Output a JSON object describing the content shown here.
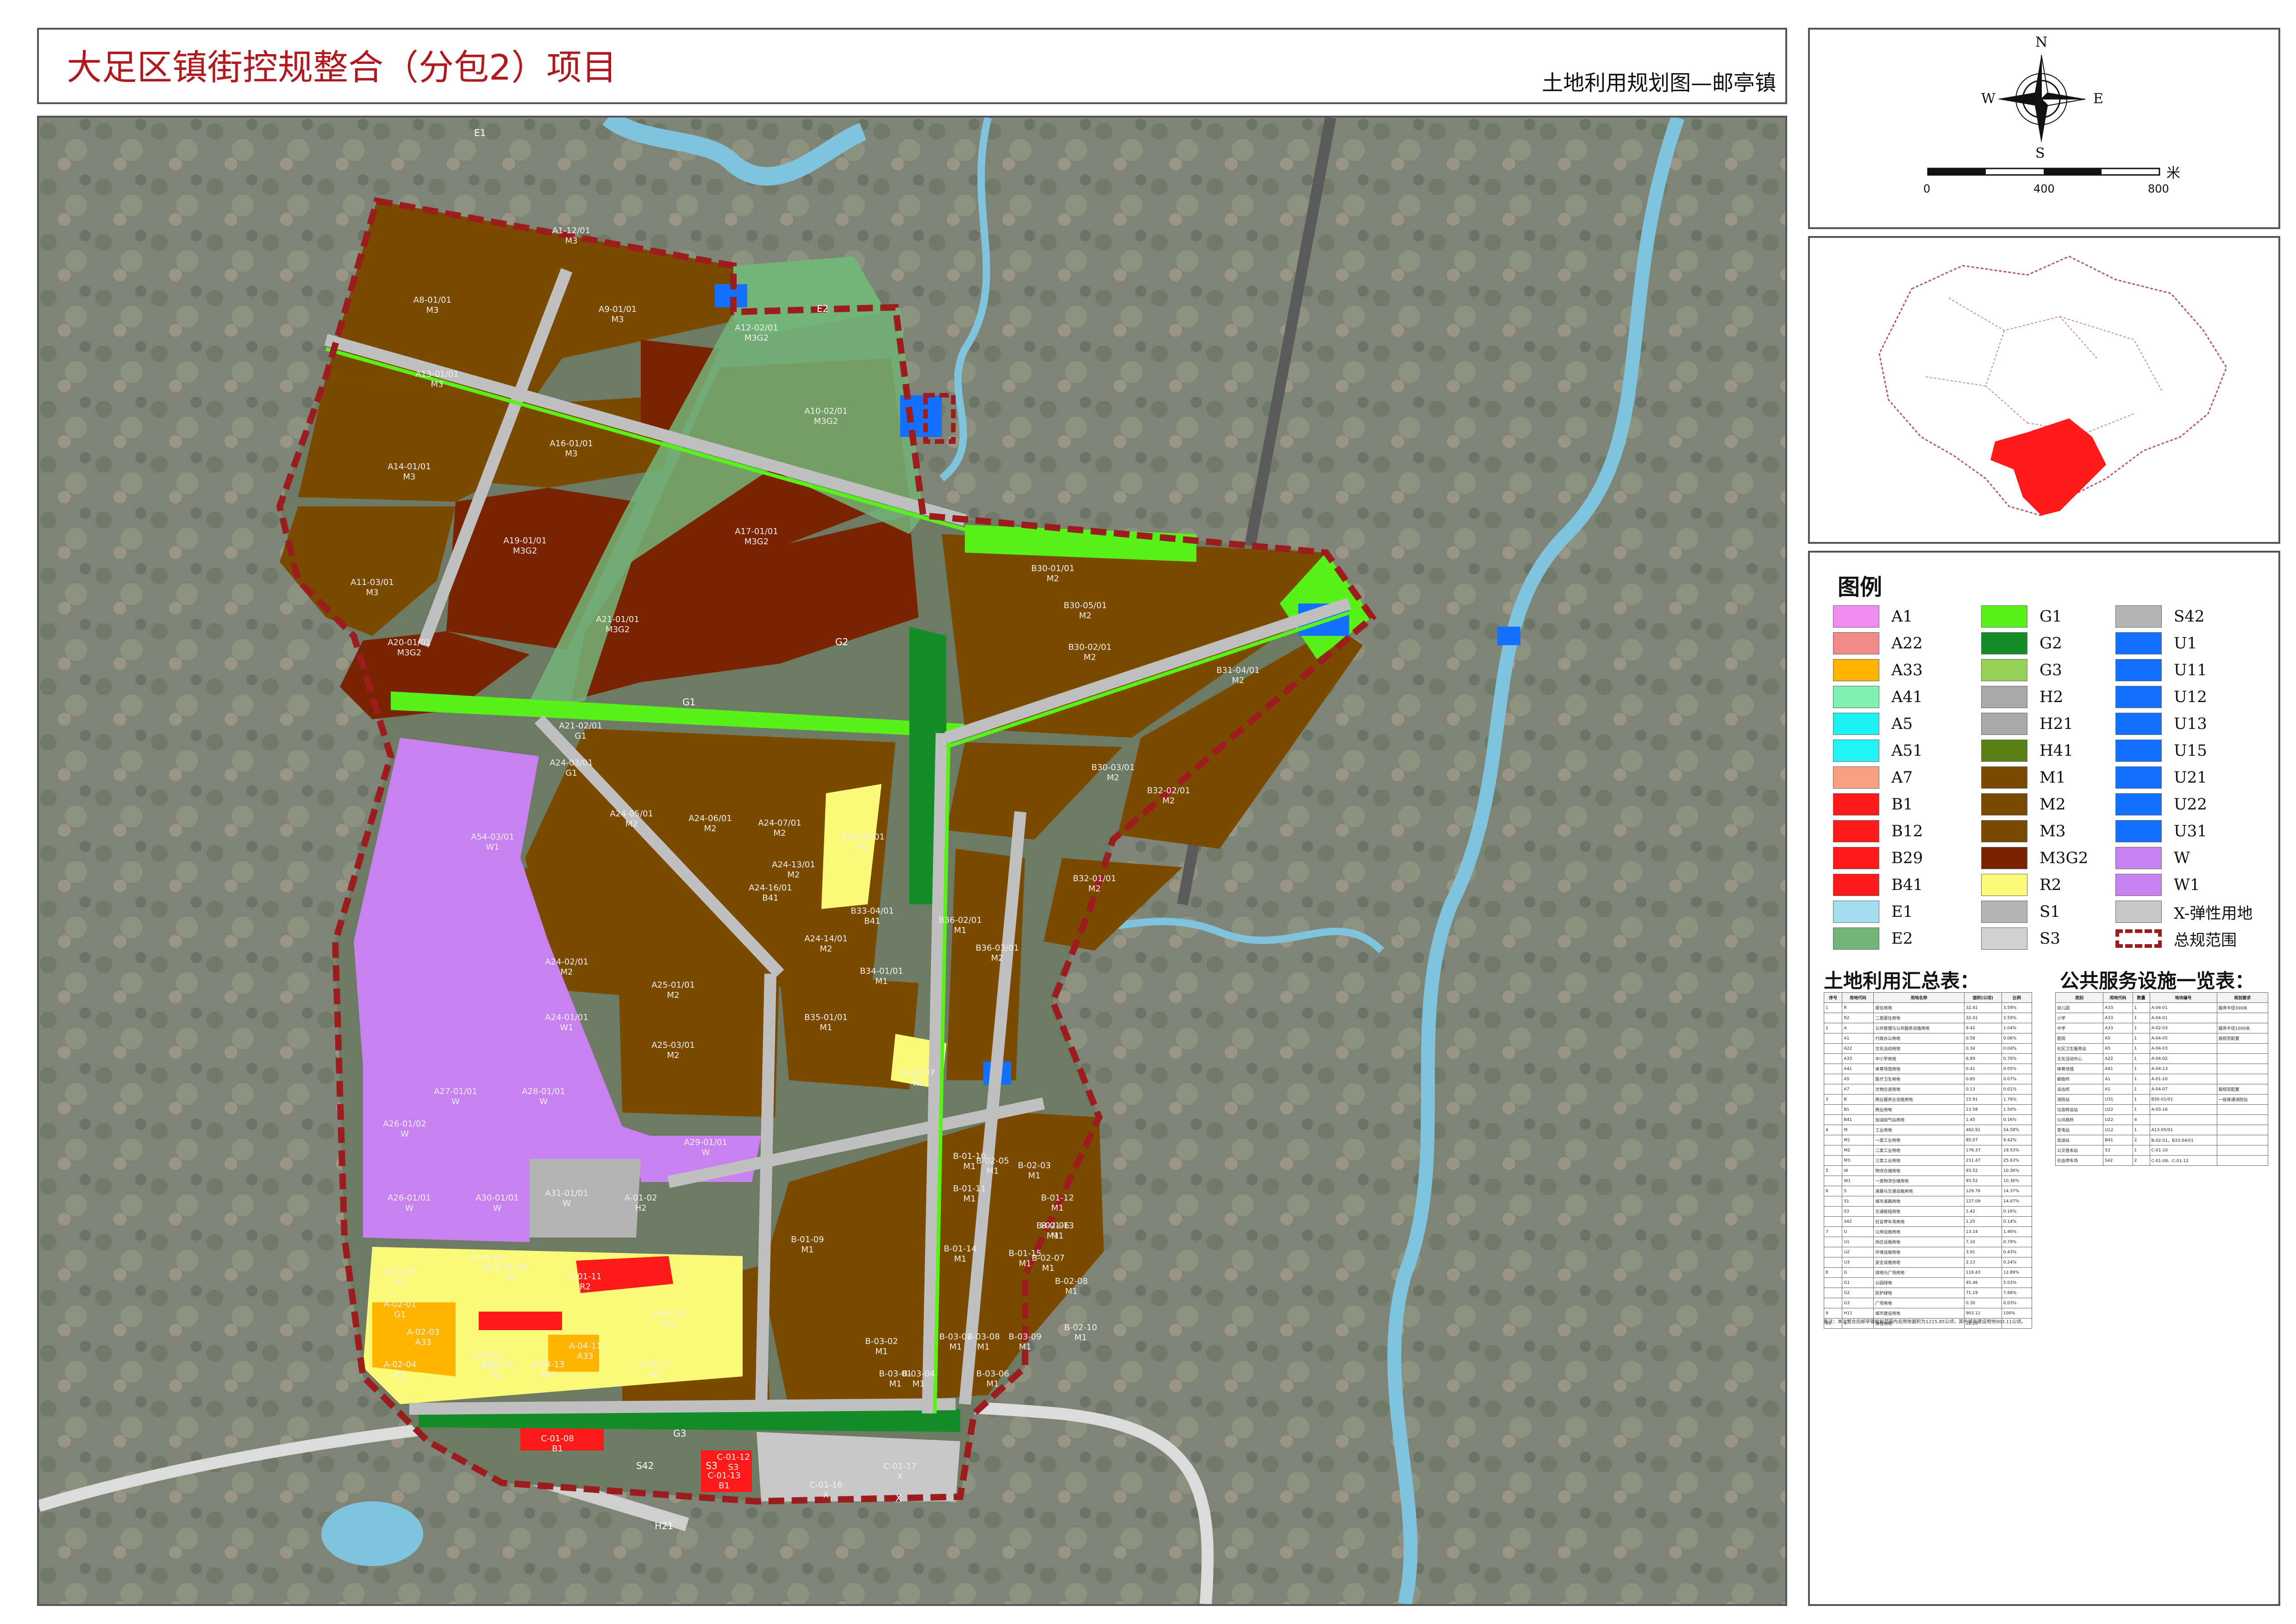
{
  "header": {
    "title": "大足区镇街控规整合（分包2）项目",
    "subtitle": "土地利用规划图—邮亭镇"
  },
  "compass": {
    "north": "N",
    "south": "S",
    "east": "E",
    "west": "W"
  },
  "scale_bar": {
    "ticks": [
      "0",
      "400",
      "800"
    ],
    "unit": "米"
  },
  "legend": {
    "title": "图例",
    "items": [
      {
        "code": "A1",
        "color": "#f08cf0"
      },
      {
        "code": "A22",
        "color": "#f08a86"
      },
      {
        "code": "A33",
        "color": "#ffb400"
      },
      {
        "code": "A41",
        "color": "#7ff2b2"
      },
      {
        "code": "A5",
        "color": "#1ef2f2"
      },
      {
        "code": "A51",
        "color": "#22f5f5"
      },
      {
        "code": "A7",
        "color": "#f7a182"
      },
      {
        "code": "B1",
        "color": "#ff1a1a"
      },
      {
        "code": "B12",
        "color": "#ff1a1a"
      },
      {
        "code": "B29",
        "color": "#ff1a1a"
      },
      {
        "code": "B41",
        "color": "#ff1a1a"
      },
      {
        "code": "E1",
        "color": "#a6dcf0"
      },
      {
        "code": "E2",
        "color": "#73b478"
      },
      {
        "code": "G1",
        "color": "#59f218"
      },
      {
        "code": "G2",
        "color": "#148c28"
      },
      {
        "code": "G3",
        "color": "#96d25a"
      },
      {
        "code": "H2",
        "color": "#a8a8a8"
      },
      {
        "code": "H21",
        "color": "#a8a8a8"
      },
      {
        "code": "H41",
        "color": "#5a8214"
      },
      {
        "code": "M1",
        "color": "#7a4a00"
      },
      {
        "code": "M2",
        "color": "#7a4a00"
      },
      {
        "code": "M3",
        "color": "#7a4a00"
      },
      {
        "code": "M3G2",
        "color": "#7a2300"
      },
      {
        "code": "R2",
        "color": "#fafa78"
      },
      {
        "code": "S1",
        "color": "#b4b4b4"
      },
      {
        "code": "S3",
        "color": "#d2d2d2"
      },
      {
        "code": "S42",
        "color": "#b4b4b4"
      },
      {
        "code": "U1",
        "color": "#1470ff"
      },
      {
        "code": "U11",
        "color": "#1470ff"
      },
      {
        "code": "U12",
        "color": "#1470ff"
      },
      {
        "code": "U13",
        "color": "#1470ff"
      },
      {
        "code": "U15",
        "color": "#1470ff"
      },
      {
        "code": "U21",
        "color": "#1470ff"
      },
      {
        "code": "U22",
        "color": "#1470ff"
      },
      {
        "code": "U31",
        "color": "#1470ff"
      },
      {
        "code": "W",
        "color": "#c882f0"
      },
      {
        "code": "W1",
        "color": "#c882f0"
      },
      {
        "code": "X-弹性用地",
        "color": "#c8c8c8"
      },
      {
        "code": "总规范围",
        "color": "#9c1d1d"
      }
    ]
  },
  "land_table": {
    "title": "土地利用汇总表：",
    "headers": [
      "序号",
      "用地代码",
      "用地名称",
      "面积(公顷)",
      "比例"
    ],
    "rows": [
      [
        "1",
        "R",
        "居住用地",
        "",
        "32.41",
        "3.59%"
      ],
      [
        "",
        "R2",
        "二类居住用地",
        "",
        "32.41",
        "3.59%"
      ],
      [
        "2",
        "A",
        "公共管理与公共服务设施用地",
        "",
        "9.42",
        "1.04%"
      ],
      [
        "",
        "A1",
        "行政办公用地",
        "",
        "0.58",
        "0.06%"
      ],
      [
        "",
        "A22",
        "文化活动用地",
        "",
        "0.34",
        "0.04%"
      ],
      [
        "",
        "A33",
        "中小学用地",
        "",
        "6.89",
        "0.76%"
      ],
      [
        "",
        "A41",
        "体育场馆用地",
        "",
        "0.41",
        "0.05%"
      ],
      [
        "",
        "A5",
        "医疗卫生用地",
        "",
        "0.65",
        "0.07%"
      ],
      [
        "",
        "A7",
        "文物古迹用地",
        "",
        "0.13",
        "0.01%"
      ],
      [
        "3",
        "B",
        "商业服务业设施用地",
        "",
        "15.91",
        "1.76%"
      ],
      [
        "",
        "B1",
        "商业用地",
        "",
        "13.58",
        "1.50%"
      ],
      [
        "",
        "B41",
        "加油加气站用地",
        "",
        "1.45",
        "0.16%"
      ],
      [
        "4",
        "M",
        "工业用地",
        "",
        "492.91",
        "54.58%"
      ],
      [
        "",
        "M1",
        "一类工业用地",
        "",
        "85.07",
        "9.42%"
      ],
      [
        "",
        "M2",
        "二类工业用地",
        "",
        "176.37",
        "19.53%"
      ],
      [
        "",
        "M3",
        "三类工业用地",
        "",
        "231.47",
        "25.63%"
      ],
      [
        "5",
        "W",
        "物流仓储用地",
        "",
        "93.52",
        "10.36%"
      ],
      [
        "",
        "W1",
        "一类物流仓储用地",
        "",
        "93.52",
        "10.36%"
      ],
      [
        "6",
        "S",
        "道路与交通设施用地",
        "",
        "129.76",
        "14.37%"
      ],
      [
        "",
        "S1",
        "城市道路用地",
        "",
        "127.09",
        "14.07%"
      ],
      [
        "",
        "S3",
        "交通枢纽用地",
        "",
        "1.42",
        "0.16%"
      ],
      [
        "",
        "S42",
        "社会停车场用地",
        "",
        "1.25",
        "0.14%"
      ],
      [
        "7",
        "U",
        "公用设施用地",
        "",
        "13.14",
        "1.46%"
      ],
      [
        "",
        "U1",
        "供应设施用地",
        "",
        "7.10",
        "0.79%"
      ],
      [
        "",
        "U2",
        "环境设施用地",
        "",
        "3.91",
        "0.43%"
      ],
      [
        "",
        "U3",
        "安全设施用地",
        "",
        "2.13",
        "0.24%"
      ],
      [
        "8",
        "G",
        "绿地与广场用地",
        "",
        "116.43",
        "12.89%"
      ],
      [
        "",
        "G1",
        "公园绿地",
        "",
        "45.46",
        "5.03%"
      ],
      [
        "",
        "G2",
        "防护绿地",
        "",
        "71.19",
        "7.88%"
      ],
      [
        "",
        "G3",
        "广场用地",
        "",
        "0.30",
        "0.03%"
      ],
      [
        "9",
        "H11",
        "城市建设用地",
        "",
        "903.11",
        "100%"
      ],
      [
        "10",
        "X",
        "弹性用地",
        "",
        "22.20",
        ""
      ]
    ],
    "note": "备注：本次整合后邮亭镇规划范围内总用地面积为1215.85公顷，其中城市建设用地903.11公顷。"
  },
  "facility_table": {
    "title": "公共服务设施一览表：",
    "headers": [
      "类别",
      "用地代码",
      "数量",
      "地块编号",
      "规划要求"
    ],
    "rows": [
      [
        "幼儿园",
        "A33",
        "1",
        "A-04-01",
        "服务半径300米"
      ],
      [
        "小学",
        "A33",
        "1",
        "A-04-01",
        ""
      ],
      [
        "中学",
        "A33",
        "1",
        "A-02-03",
        "服务半径1000米"
      ],
      [
        "医院",
        "A5",
        "1",
        "A-04-05",
        "按规范配置"
      ],
      [
        "社区卫生服务站",
        "A5",
        "1",
        "A-04-03",
        ""
      ],
      [
        "文化活动中心",
        "A22",
        "1",
        "A-04-02",
        ""
      ],
      [
        "体育场馆",
        "A41",
        "1",
        "A-04-13",
        ""
      ],
      [
        "邮政所",
        "A1",
        "1",
        "A-01-10",
        ""
      ],
      [
        "派出所",
        "A1",
        "1",
        "A-04-07",
        "按规范配置"
      ],
      [
        "消防站",
        "U31",
        "1",
        "B30-01/01",
        "一级普通消防站"
      ],
      [
        "垃圾转运站",
        "U22",
        "1",
        "A-03-16",
        ""
      ],
      [
        "公共厕所",
        "U22",
        "4",
        "",
        ""
      ],
      [
        "变电站",
        "U12",
        "1",
        "A13-05/01",
        ""
      ],
      [
        "加油站",
        "B41",
        "2",
        "B-02-01、B33-04/01",
        ""
      ],
      [
        "公交首末站",
        "S3",
        "1",
        "C-01-10",
        ""
      ],
      [
        "社会停车场",
        "S42",
        "2",
        "C-01-08、C-01-12",
        ""
      ]
    ]
  },
  "map": {
    "labels": [
      {
        "t": "A1-12/01",
        "s": "M3"
      },
      {
        "t": "A8-01/01",
        "s": "M3"
      },
      {
        "t": "A9-01/01",
        "s": "M3"
      },
      {
        "t": "A10-02/01",
        "s": "M3G2"
      },
      {
        "t": "A12-02/01",
        "s": "M3G2"
      },
      {
        "t": "A13-01/01",
        "s": "M3"
      },
      {
        "t": "A14-01/01",
        "s": "M3"
      },
      {
        "t": "A16-01/01",
        "s": "M3"
      },
      {
        "t": "A17-01/01",
        "s": "M3G2"
      },
      {
        "t": "A19-01/01",
        "s": "M3G2"
      },
      {
        "t": "A20-01/01",
        "s": "M3G2"
      },
      {
        "t": "A21-01/01",
        "s": "M3G2"
      },
      {
        "t": "A11-03/01",
        "s": "M3"
      },
      {
        "t": "A21-02/01",
        "s": "G1"
      },
      {
        "t": "A24-03/01",
        "s": "G1"
      },
      {
        "t": "A24-05/01",
        "s": "M2"
      },
      {
        "t": "A24-06/01",
        "s": "M2"
      },
      {
        "t": "A24-07/01",
        "s": "M2"
      },
      {
        "t": "A24-13/01",
        "s": "M2"
      },
      {
        "t": "A24-14/01",
        "s": "M2"
      },
      {
        "t": "A24-16/01",
        "s": "B41"
      },
      {
        "t": "A54-03/01",
        "s": "W1"
      },
      {
        "t": "A24-02/01",
        "s": "M2"
      },
      {
        "t": "A24-01/01",
        "s": "W1"
      },
      {
        "t": "A27-01/01",
        "s": "W"
      },
      {
        "t": "A28-01/01",
        "s": "W"
      },
      {
        "t": "A26-01/02",
        "s": "W"
      },
      {
        "t": "A26-01/01",
        "s": "W"
      },
      {
        "t": "A30-01/01",
        "s": "W"
      },
      {
        "t": "A31-01/01",
        "s": "W"
      },
      {
        "t": "A29-01/01",
        "s": "W"
      },
      {
        "t": "B30-01/01",
        "s": "M2"
      },
      {
        "t": "B30-05/01",
        "s": "M2"
      },
      {
        "t": "B30-02/01",
        "s": "M2"
      },
      {
        "t": "B30-03/01",
        "s": "M2"
      },
      {
        "t": "B31-04/01",
        "s": "M2"
      },
      {
        "t": "B32-02/01",
        "s": "M2"
      },
      {
        "t": "B32-01/01",
        "s": "M2"
      },
      {
        "t": "B33-02/01",
        "s": "R2"
      },
      {
        "t": "B33-04/01",
        "s": "B41"
      },
      {
        "t": "B34-01/01",
        "s": "M1"
      },
      {
        "t": "B35-01/01",
        "s": "M1"
      },
      {
        "t": "B36-03/01",
        "s": "M2"
      },
      {
        "t": "B-01-07",
        "s": "R2"
      },
      {
        "t": "B-01-10",
        "s": "M1"
      },
      {
        "t": "B-01-11",
        "s": "M1"
      },
      {
        "t": "B-01-12",
        "s": "M1"
      },
      {
        "t": "B-01-13",
        "s": "M1"
      },
      {
        "t": "B-01-14",
        "s": "M1"
      },
      {
        "t": "B-01-15",
        "s": "M1"
      },
      {
        "t": "B-02-03",
        "s": "M1"
      },
      {
        "t": "B-02-05",
        "s": "M1"
      },
      {
        "t": "B-02-06",
        "s": "M1"
      },
      {
        "t": "B-02-07",
        "s": "M1"
      },
      {
        "t": "B-02-08",
        "s": "M1"
      },
      {
        "t": "B-02-10",
        "s": "M1"
      },
      {
        "t": "B-03-01",
        "s": "M1"
      },
      {
        "t": "B-03-02",
        "s": "M1"
      },
      {
        "t": "B-03-04",
        "s": "M1"
      },
      {
        "t": "B-03-06",
        "s": "M1"
      },
      {
        "t": "B-03-07",
        "s": "M1"
      },
      {
        "t": "B-03-08",
        "s": "M1"
      },
      {
        "t": "B-03-09",
        "s": "M1"
      },
      {
        "t": "A-01-07",
        "s": "R2"
      },
      {
        "t": "A-01-02",
        "s": "R2"
      },
      {
        "t": "A-01-04",
        "s": "R2"
      },
      {
        "t": "A-01-11",
        "s": "R2"
      },
      {
        "t": "A-02-01",
        "s": "G1"
      },
      {
        "t": "A-02-03",
        "s": "A33"
      },
      {
        "t": "A-02-04",
        "s": "R2"
      },
      {
        "t": "A-03-02",
        "s": "R2"
      },
      {
        "t": "A-04-11",
        "s": "A33"
      },
      {
        "t": "A-04-12",
        "s": "R2"
      },
      {
        "t": "A-04-13",
        "s": "A41"
      },
      {
        "t": "A-04-17",
        "s": "M1"
      },
      {
        "t": "A-03-14",
        "s": "M1"
      },
      {
        "t": "C-01-08",
        "s": "B1"
      },
      {
        "t": "C-01-16",
        "s": "X"
      },
      {
        "t": "C-01-17",
        "s": "X"
      },
      {
        "t": "C-01-12",
        "s": "S3"
      },
      {
        "t": "C-01-13",
        "s": "B1"
      },
      {
        "t": "B-01-09",
        "s": "M1"
      },
      {
        "t": "B36-02/01",
        "s": "M1"
      },
      {
        "t": "A25-01/01",
        "s": "M2"
      },
      {
        "t": "A25-03/01",
        "s": "M2"
      },
      {
        "t": "A-01-02",
        "s": "H2"
      }
    ],
    "place_labels": [
      "E1",
      "E2",
      "G1",
      "G2",
      "H21",
      "S42",
      "S3",
      "G3",
      "X"
    ]
  }
}
